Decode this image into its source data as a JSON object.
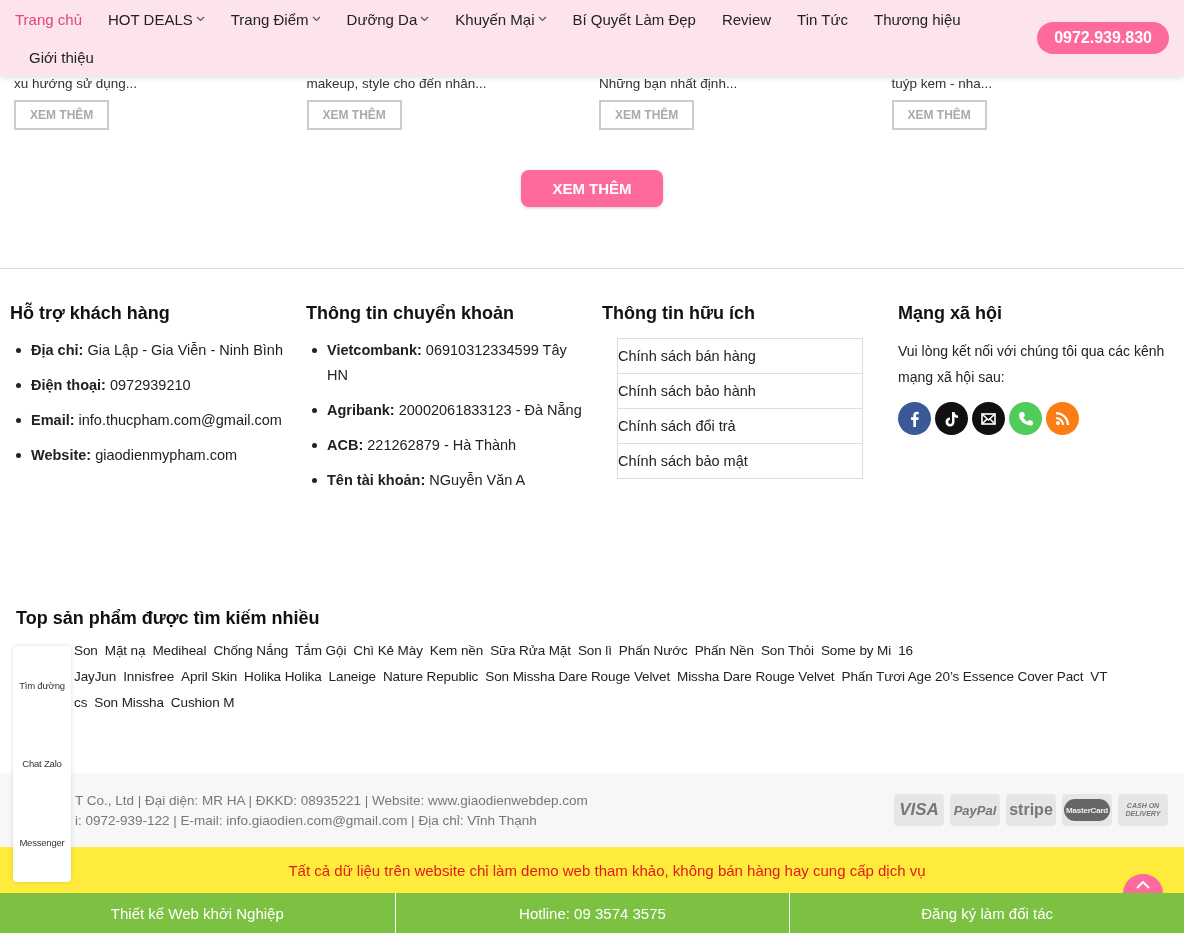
{
  "nav": {
    "items": [
      {
        "label": "Trang chủ",
        "selected": true,
        "has_dropdown": false
      },
      {
        "label": "HOT DEALS",
        "selected": false,
        "has_dropdown": true
      },
      {
        "label": "Trang Điểm",
        "selected": false,
        "has_dropdown": true
      },
      {
        "label": "Dưỡng Da",
        "selected": false,
        "has_dropdown": true
      },
      {
        "label": "Khuyến Mại",
        "selected": false,
        "has_dropdown": true
      },
      {
        "label": "Bí Quyết Làm Đẹp",
        "selected": false,
        "has_dropdown": false
      },
      {
        "label": "Review",
        "selected": false,
        "has_dropdown": false
      },
      {
        "label": "Tin Tức",
        "selected": false,
        "has_dropdown": false
      },
      {
        "label": "Thương hiệu",
        "selected": false,
        "has_dropdown": false
      },
      {
        "label": "Giới thiệu",
        "selected": false,
        "has_dropdown": false
      }
    ],
    "phone": "0972.939.830"
  },
  "posts": [
    {
      "excerpt": "xu hướng sử dụng...",
      "button": "XEM THÊM"
    },
    {
      "excerpt": "makeup, style cho đến nhân...",
      "button": "XEM THÊM"
    },
    {
      "excerpt": "Những bạn nhất định...",
      "button": "XEM THÊM"
    },
    {
      "excerpt": "tuýp kem - nha...",
      "button": "XEM THÊM"
    }
  ],
  "load_more": "XEM THÊM",
  "footer": {
    "support": {
      "title": "Hỗ trợ khách hàng",
      "items": [
        {
          "label": "Địa chỉ:",
          "value": "Gia Lập - Gia Viễn - Ninh Bình"
        },
        {
          "label": "Điện thoại:",
          "value": "0972939210"
        },
        {
          "label": "Email:",
          "value": "info.thucpham.com@gmail.com"
        },
        {
          "label": "Website:",
          "value": "giaodienmypham.com"
        }
      ]
    },
    "transfer": {
      "title": "Thông tin chuyển khoản",
      "items": [
        {
          "label": "Vietcombank:",
          "value": "06910312334599 Tây HN"
        },
        {
          "label": "Agribank:",
          "value": "20002061833123 - Đà Nẵng"
        },
        {
          "label": "ACB:",
          "value": "221262879 - Hà Thành"
        },
        {
          "label": "Tên tài khoản:",
          "value": "NGuyễn Văn A"
        }
      ]
    },
    "useful": {
      "title": "Thông tin hữu ích",
      "links": [
        "Chính sách bán hàng",
        "Chính sách bảo hành",
        "Chính sách đổi trả",
        "Chính sách bảo mật"
      ]
    },
    "social": {
      "title": "Mạng xã hội",
      "text": "Vui lòng kết nối với chúng tôi qua các kênh mạng xã hội sau:",
      "icons": [
        {
          "kind": "facebook",
          "color": "#3b5998"
        },
        {
          "kind": "tiktok",
          "color": "#111111"
        },
        {
          "kind": "email",
          "color": "#111111"
        },
        {
          "kind": "phone",
          "color": "#51cb5a"
        },
        {
          "kind": "rss",
          "color": "#fc7d16"
        }
      ]
    }
  },
  "top_searches": {
    "title": "Top sản phẩm được tìm kiếm nhiều",
    "tag_rows": [
      [
        "Son",
        "Mặt nạ",
        "Mediheal",
        "Chống Nắng",
        "Tắm Gội",
        "Chì Kẻ Mày",
        "Kem nền",
        "Sữa Rửa Mặt",
        "Son lì",
        "Phấn Nước",
        "Phấn Nền",
        "Son Thỏi",
        "Some by Mi",
        "16"
      ],
      [
        "JayJun",
        "Innisfree",
        "April Skin",
        "Holika Holika",
        "Laneige",
        "Nature Republic",
        "Son Missha Dare Rouge Velvet",
        "Missha Dare Rouge Velvet",
        "Phấn Tươi Age 20’s Essence Cover Pact",
        "VT"
      ],
      [
        "cs",
        "Son Missha",
        "Cushion M"
      ]
    ]
  },
  "contact_widget": [
    "Tìm đường",
    "Chat Zalo",
    "Messenger"
  ],
  "copyright": [
    "T Co., Ltd | Đại diện: MR HA | ĐKKD: 08935221 | Website: www.giaodienwebdep.com",
    "i: 0972-939-122 | E-mail: info.giaodien.com@gmail.com | Địa chỉ: Vĩnh Thạnh"
  ],
  "payments": [
    {
      "kind": "visa",
      "label": "VISA"
    },
    {
      "kind": "paypal",
      "label": "PayPal"
    },
    {
      "kind": "stripe",
      "label": "stripe"
    },
    {
      "kind": "mastercard",
      "label": "MasterCard"
    },
    {
      "kind": "cod",
      "label": "CASH ON DELIVERY"
    }
  ],
  "notice": "Tất cả dữ liệu trên website chỉ làm demo web tham khảo, không bán hàng hay cung cấp dịch vụ",
  "bottom_bar": [
    "Thiết kế Web khởi Nghiệp",
    "Hotline: 09 3574 3575",
    "Đăng ký làm đối tác"
  ]
}
